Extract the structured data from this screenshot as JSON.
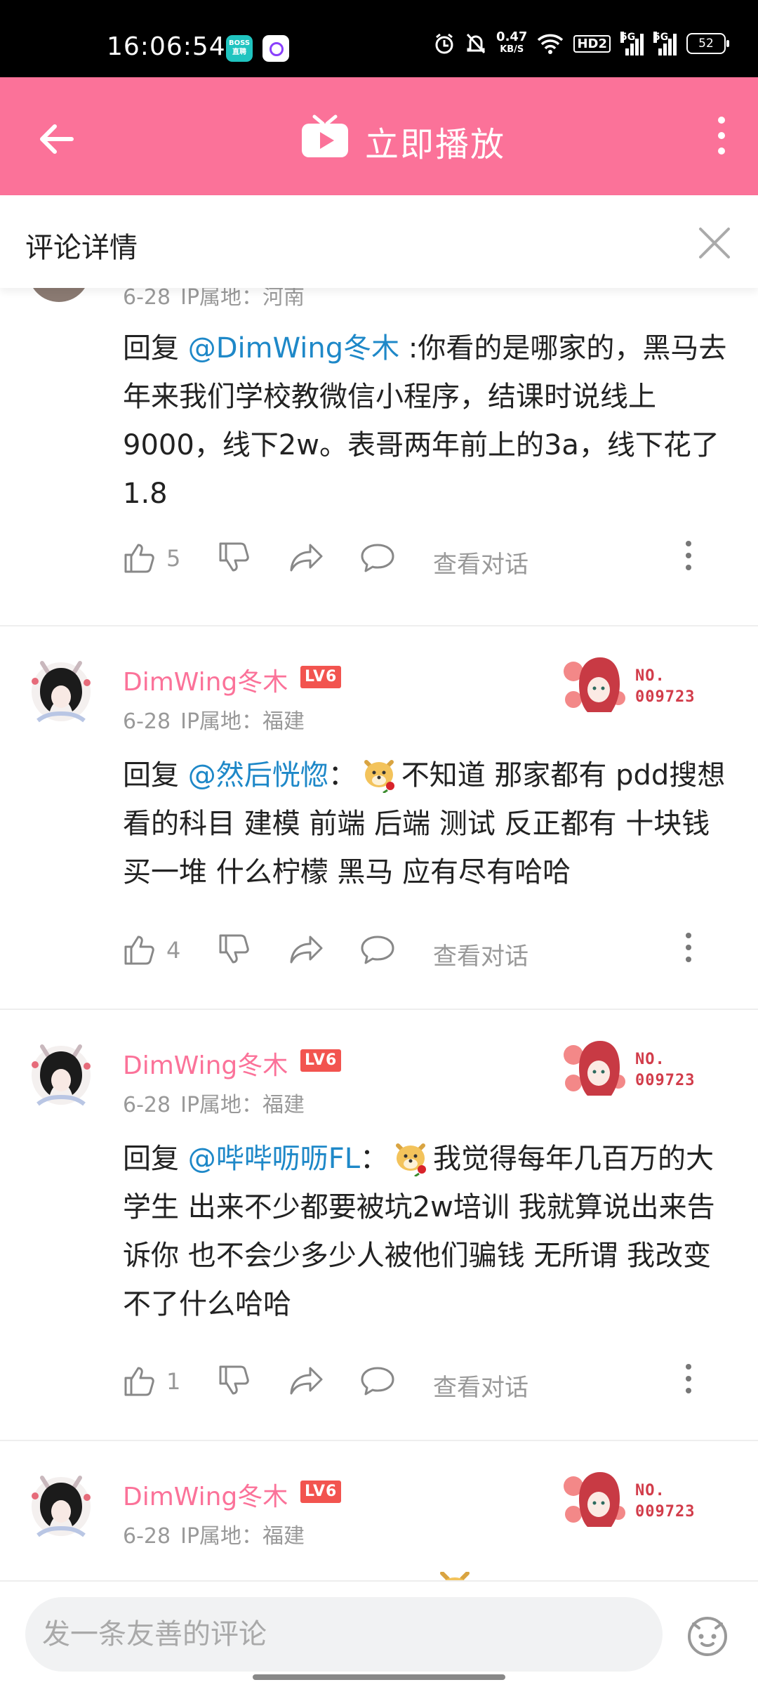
{
  "status_bar": {
    "time": "16:06:54",
    "app_badge": "BOSS直聘",
    "net_speed_value": "0.47",
    "net_speed_unit": "KB/S",
    "hd": "HD2",
    "sig1": "5G",
    "sig2": "5G",
    "battery": "52"
  },
  "header": {
    "title": "立即播放",
    "back_icon": "arrow-left-icon",
    "more_icon": "more-vertical-icon",
    "accent": "#fb7299"
  },
  "panel": {
    "title": "评论详情",
    "close_icon": "close-icon"
  },
  "partial": {
    "date": "6-28",
    "ip": "IP属地：河南"
  },
  "comments": [
    {
      "reply_prefix": "回复",
      "mention": "@DimWing冬木",
      "sep": " :",
      "body": "你看的是哪家的，黑马去年来我们学校教微信小程序，结课时说线上9000，线下2w。表哥两年前上的3a，线下花了1.8",
      "likes": "5",
      "view": "查看对话"
    },
    {
      "user": "DimWing冬木",
      "level": "LV6",
      "date": "6-28",
      "ip": "IP属地：福建",
      "card_no": "NO.",
      "card_id": "009723",
      "reply_prefix": "回复",
      "mention": "@然后恍惚",
      "sep": "：",
      "body": "不知道 那家都有 pdd搜想看的科目 建模 前端 后端 测试 反正都有 十块钱买一堆 什么柠檬 黑马 应有尽有哈哈",
      "likes": "4",
      "view": "查看对话"
    },
    {
      "user": "DimWing冬木",
      "level": "LV6",
      "date": "6-28",
      "ip": "IP属地：福建",
      "card_no": "NO.",
      "card_id": "009723",
      "reply_prefix": "回复",
      "mention": "@哔哔呖呖FL",
      "sep": "：",
      "body": "我觉得每年几百万的大学生 出来不少都要被坑2w培训 我就算说出来告诉你 也不会少多少人被他们骗钱 无所谓 我改变不了什么哈哈",
      "likes": "1",
      "view": "查看对话"
    },
    {
      "user": "DimWing冬木",
      "level": "LV6",
      "date": "6-28",
      "ip": "IP属地：福建",
      "card_no": "NO.",
      "card_id": "009723"
    }
  ],
  "bottom": {
    "placeholder": "发一条友善的评论"
  }
}
